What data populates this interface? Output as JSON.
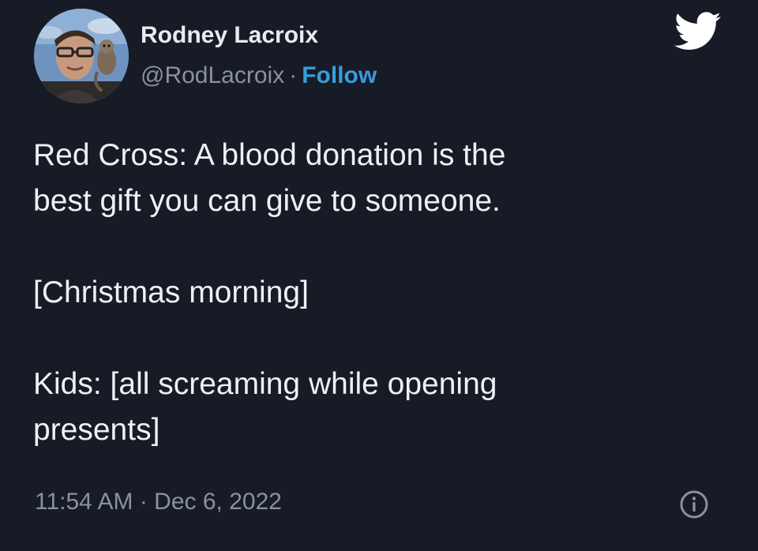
{
  "tweet": {
    "author_name": "Rodney Lacroix",
    "handle": "@RodLacroix",
    "separator": "·",
    "follow_label": "Follow",
    "text_lines": [
      "Red Cross: A blood donation is the",
      "best gift you can give to someone.",
      "[Christmas morning]",
      "Kids: [all screaming while opening",
      "presents]"
    ],
    "timestamp": "11:54 AM · Dec 6, 2022"
  },
  "icons": {
    "brand": "twitter-bird-icon",
    "info": "info-icon",
    "avatar": "profile-photo"
  },
  "colors": {
    "background": "#171b25",
    "link": "#3a9bdc",
    "muted": "#8a929d",
    "text": "#eef0f3"
  }
}
